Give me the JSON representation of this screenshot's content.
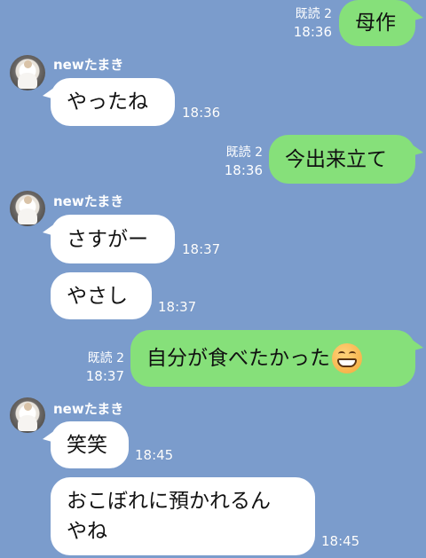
{
  "chat": {
    "contact_name": "newたまき",
    "colors": {
      "background": "#7b9ccc",
      "incoming": "#ffffff",
      "outgoing": "#86e07a"
    },
    "messages": [
      {
        "dir": "out",
        "text": "母作",
        "read": "既読 2",
        "time": "18:36"
      },
      {
        "dir": "in",
        "text": "やったね",
        "time": "18:36"
      },
      {
        "dir": "out",
        "text": "今出来立て",
        "read": "既読 2",
        "time": "18:36"
      },
      {
        "dir": "in",
        "text": "さすがー",
        "time": "18:37"
      },
      {
        "dir": "in",
        "text": "やさし",
        "time": "18:37"
      },
      {
        "dir": "out",
        "text": "自分が食べたかった",
        "emoji": "grinning-face-icon",
        "read": "既読 2",
        "time": "18:37"
      },
      {
        "dir": "in",
        "text": "笑笑",
        "time": "18:45"
      },
      {
        "dir": "in",
        "text_line1": "おこぼれに預かれるん",
        "text_line2": "やね",
        "time": "18:45"
      }
    ]
  }
}
